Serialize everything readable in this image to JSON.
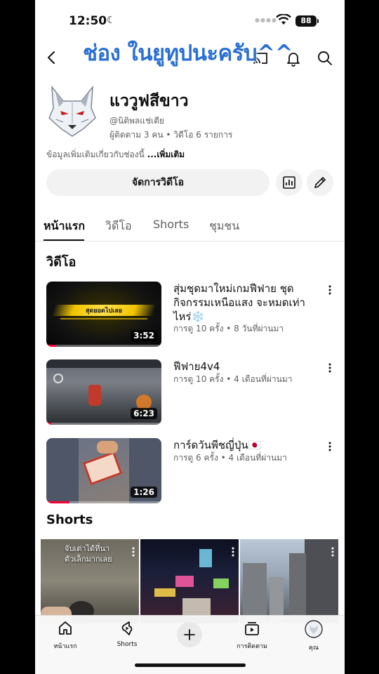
{
  "status_bar": {
    "time": "12:50",
    "battery": "88"
  },
  "overlay_caption": "ช่อง ในยูทูปนะครับ^^",
  "channel": {
    "name": "แววูฟสีขาว",
    "handle": "@นิติพลแช่เตีย",
    "stats": "ผู้ติดตาม 3 คน • วิดีโอ 6 รายการ",
    "about": "ข้อมูลเพิ่มเติมเกี่ยวกับช่องนี้ ",
    "about_more": "...เพิ่มเติม"
  },
  "manage_button": "จัดการวิดีโอ",
  "tabs": [
    {
      "label": "หน้าแรก",
      "active": true
    },
    {
      "label": "วิดีโอ",
      "active": false
    },
    {
      "label": "Shorts",
      "active": false
    },
    {
      "label": "ชุมชน",
      "active": false
    }
  ],
  "videos_section_title": "วิดีโอ",
  "videos": [
    {
      "title": "สุ่มชุดมาใหม่เกมฟีฟาย ชุดกิจกรรมเหนือแสง จะหมดเท่าไหร่❄️",
      "meta": "การดู 10 ครั้ง • 8 วันที่ผ่านมา",
      "duration": "3:52",
      "thumb_text": "สุดยอดไปเลย",
      "watched": 0.08
    },
    {
      "title": "ฟีฟาย4v4",
      "meta": "การดู 10 ครั้ง • 4 เดือนที่ผ่านมา",
      "duration": "6:23",
      "watched": 0.04
    },
    {
      "title": "การ์ดวันพีชญี่ปุ่น🇯🇵",
      "meta": "การดู 6 ครั้ง • 4 เดือนที่ผ่านมา",
      "duration": "1:26",
      "watched": 0.2
    }
  ],
  "shorts_section_title": "Shorts",
  "shorts": [
    {
      "caption_line1": "จับเต่าได้ที่นา",
      "caption_line2": "ตัวเล็กมากเลย"
    },
    {
      "caption_line1": "",
      "caption_line2": ""
    },
    {
      "caption_line1": "",
      "caption_line2": ""
    }
  ],
  "bottom_nav": {
    "home": "หน้าแรก",
    "shorts": "Shorts",
    "subscriptions": "การติดตาม",
    "you": "คุณ"
  },
  "colors": {
    "caption_blue": "#2a6fd3",
    "youtube_red": "#ff0033"
  }
}
